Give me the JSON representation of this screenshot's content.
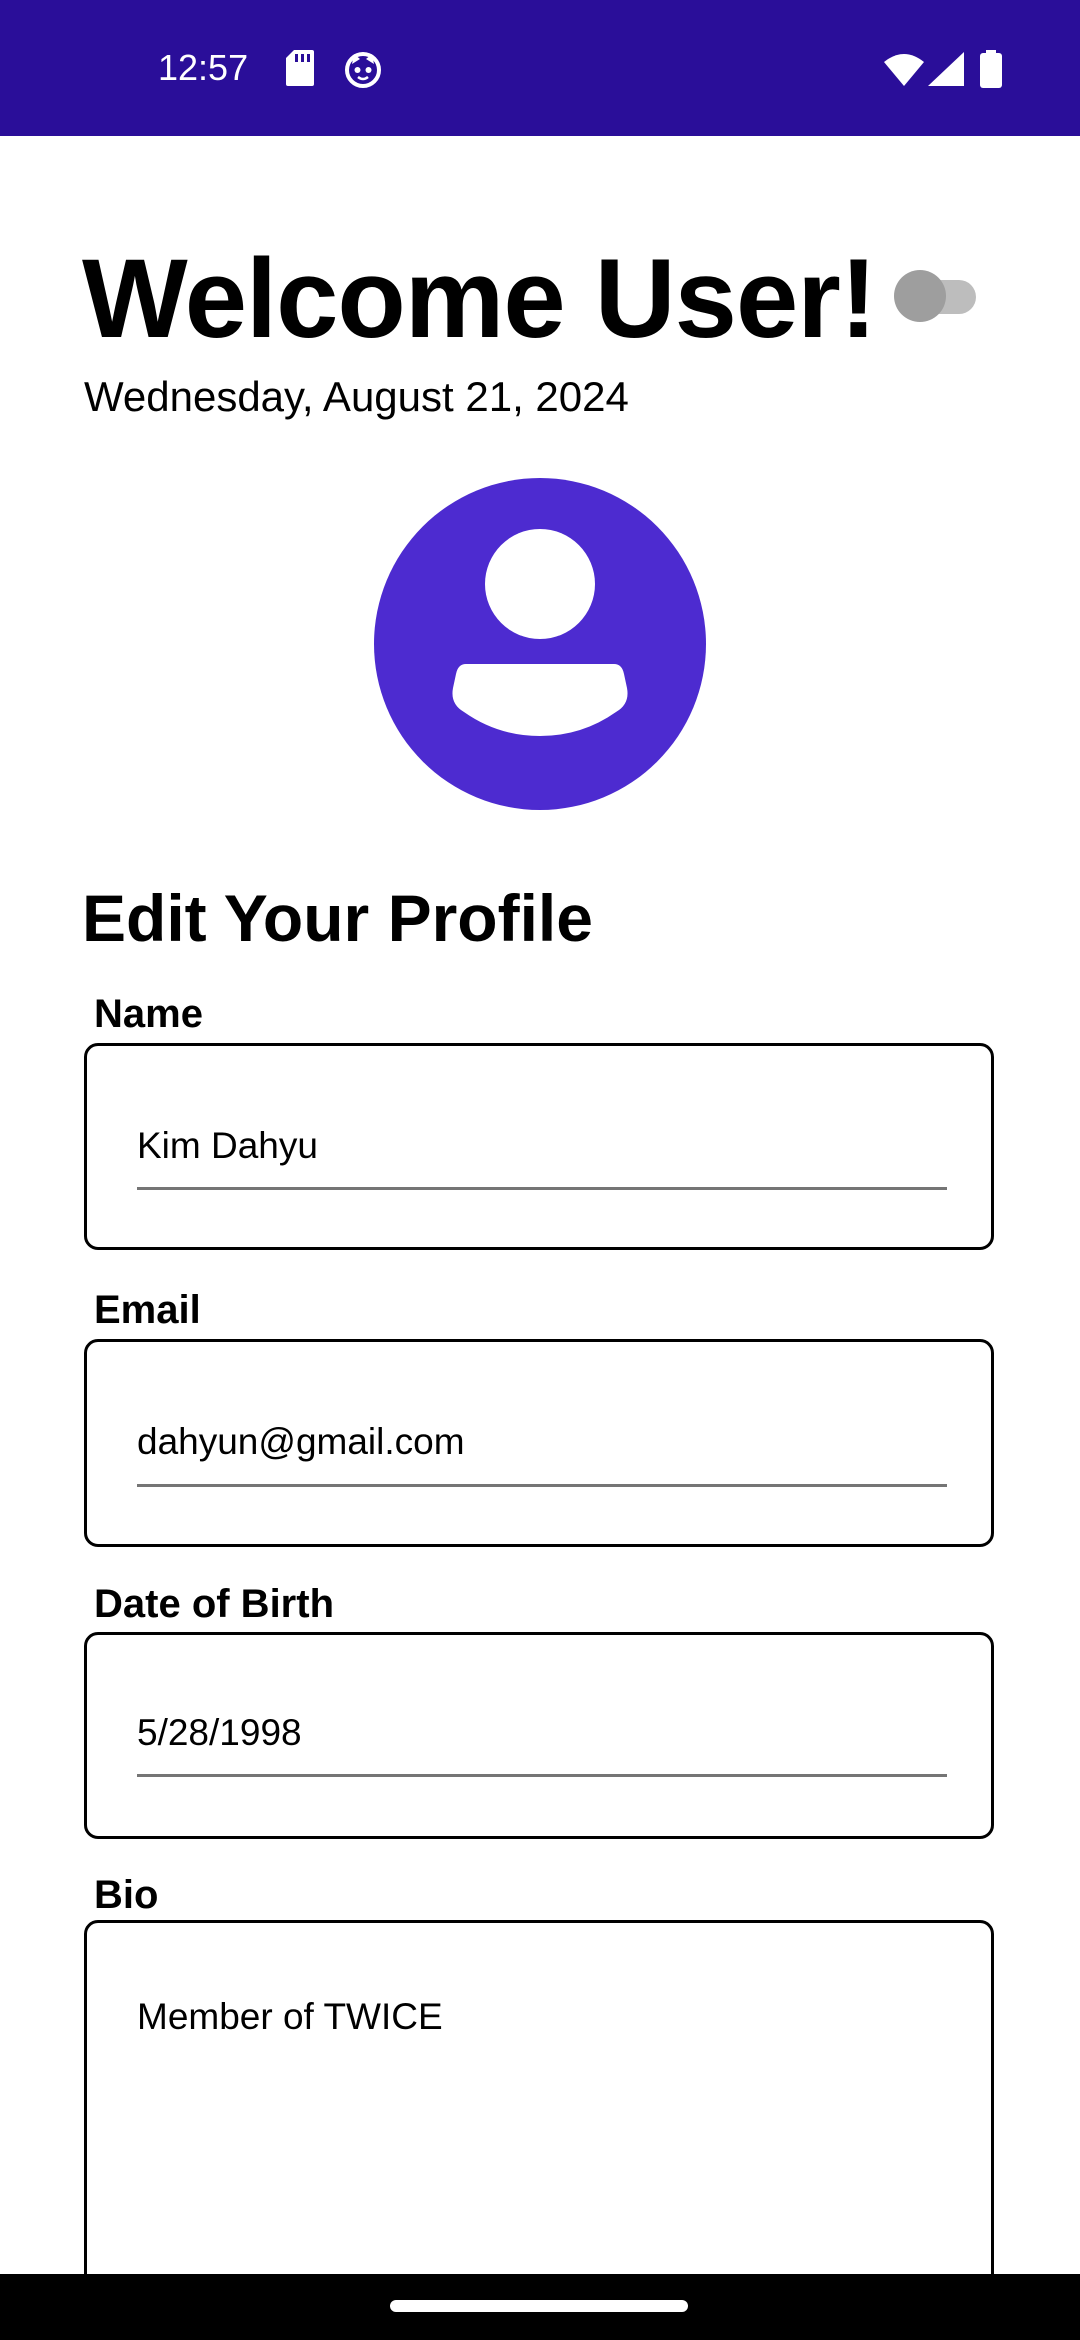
{
  "status_bar": {
    "time": "12:57",
    "background_color": "#2a0e99",
    "icons": [
      "sd-card-icon",
      "cat-face-icon",
      "wifi-icon",
      "cellular-signal-icon",
      "battery-icon"
    ]
  },
  "header": {
    "title": "Welcome User!",
    "date": "Wednesday, August 21, 2024",
    "theme_toggle_on": false
  },
  "avatar": {
    "icon": "account-circle-icon",
    "color": "#4d2bd0"
  },
  "form": {
    "title": "Edit Your Profile",
    "fields": {
      "name": {
        "label": "Name",
        "value": "Kim Dahyu"
      },
      "email": {
        "label": "Email",
        "value": "dahyun@gmail.com"
      },
      "dob": {
        "label": "Date of Birth",
        "value": "5/28/1998"
      },
      "bio": {
        "label": "Bio",
        "value": "Member of TWICE"
      }
    }
  }
}
